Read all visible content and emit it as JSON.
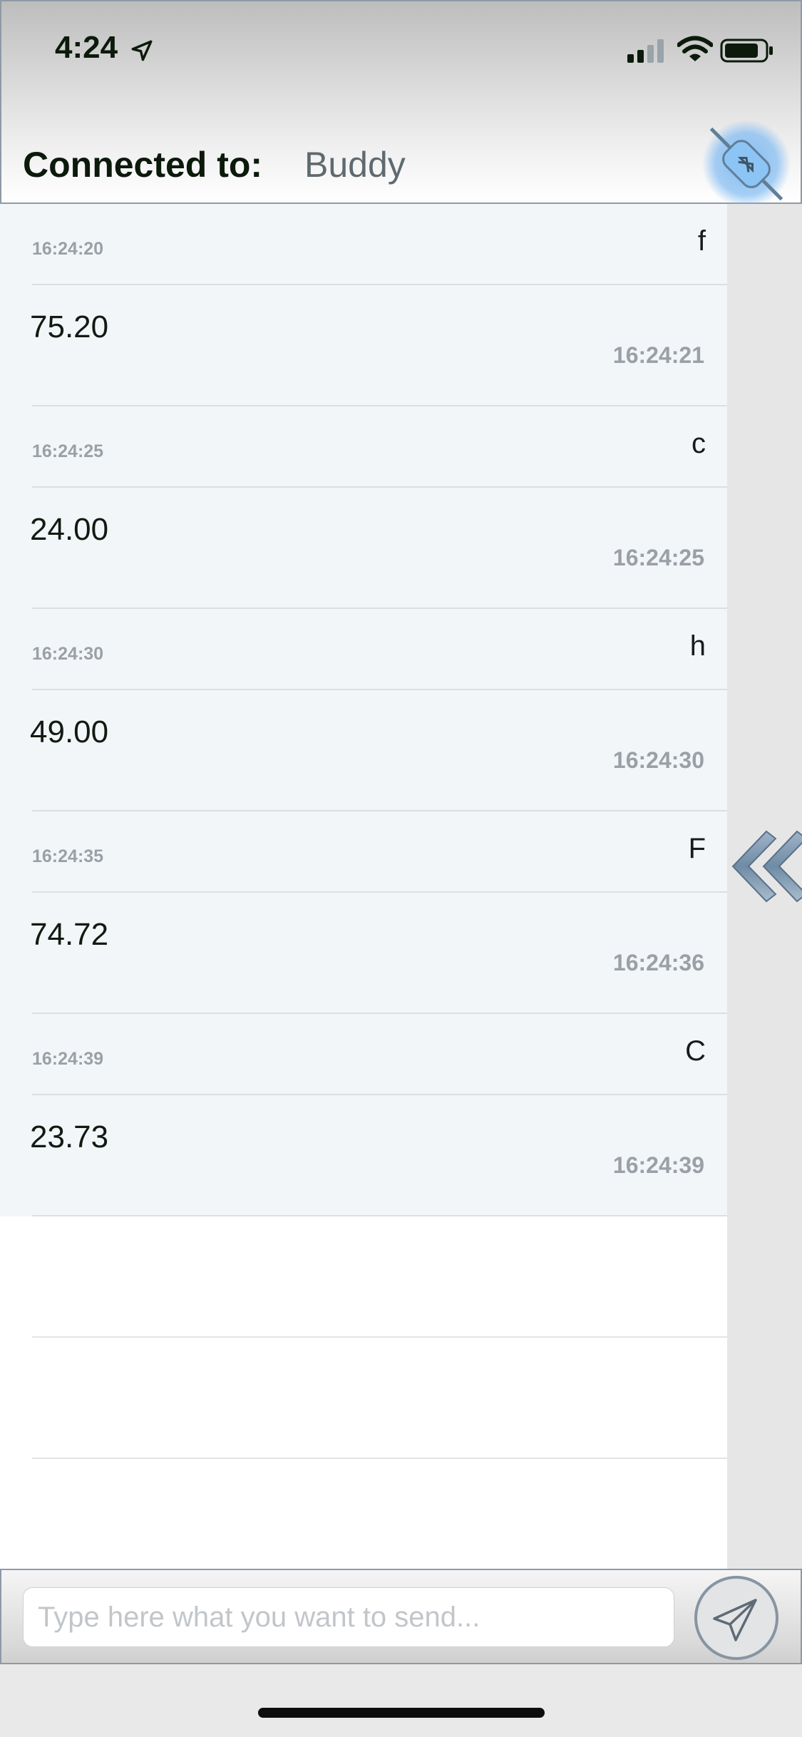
{
  "status_bar": {
    "time": "4:24"
  },
  "header": {
    "connected_label": "Connected to:",
    "device_name": "Buddy"
  },
  "messages": [
    {
      "sent": "f",
      "sent_time": "16:24:20",
      "reply": "75.20",
      "reply_time": "16:24:21"
    },
    {
      "sent": "c",
      "sent_time": "16:24:25",
      "reply": "24.00",
      "reply_time": "16:24:25"
    },
    {
      "sent": "h",
      "sent_time": "16:24:30",
      "reply": "49.00",
      "reply_time": "16:24:30"
    },
    {
      "sent": "F",
      "sent_time": "16:24:35",
      "reply": "74.72",
      "reply_time": "16:24:36"
    },
    {
      "sent": "C",
      "sent_time": "16:24:39",
      "reply": "23.73",
      "reply_time": "16:24:39"
    }
  ],
  "input": {
    "placeholder": "Type here what you want to send...",
    "value": ""
  },
  "icons": {
    "location": "location-arrow-icon",
    "signal": "cellular-signal-icon",
    "wifi": "wifi-icon",
    "battery": "battery-icon",
    "plug": "bluetooth-plug-icon",
    "collapse": "double-chevron-left-icon",
    "send": "paper-plane-icon"
  },
  "colors": {
    "plug_glow": "#7fbaf2",
    "list_background": "#f3f6f9",
    "timestamp": "#9aa0a6"
  }
}
